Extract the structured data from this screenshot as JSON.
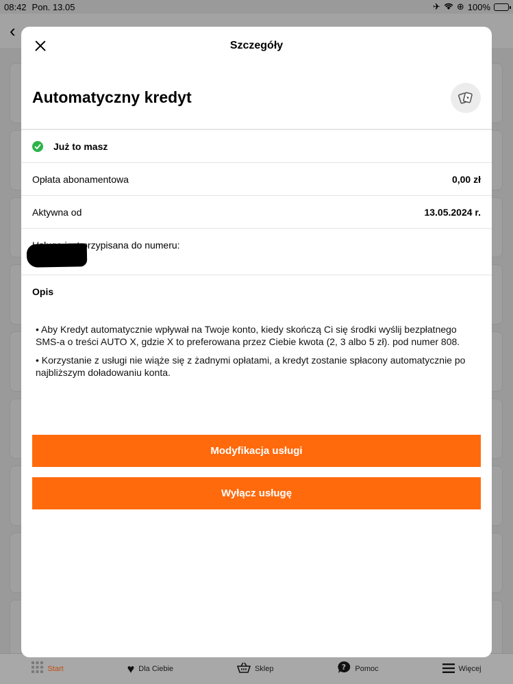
{
  "status_bar": {
    "time": "08:42",
    "date": "Pon. 13.05",
    "battery": "100%"
  },
  "modal": {
    "title": "Szczegóły",
    "service_name": "Automatyczny kredyt",
    "owned_label": "Już to masz",
    "fee_label": "Opłata abonamentowa",
    "fee_value": "0,00 zł",
    "active_label": "Aktywna od",
    "active_value": "13.05.2024 r.",
    "assigned_label": "Usługa jest przypisana do numeru:",
    "description_title": "Opis",
    "description_items": [
      "• Aby Kredyt automatycznie wpływał na Twoje konto, kiedy skończą Ci się środki wyślij bezpłatnego SMS-a o treści AUTO X, gdzie X to preferowana przez Ciebie kwota (2, 3 albo 5 zł). pod numer 808.",
      "• Korzystanie z usługi nie wiąże się z żadnymi opłatami, a kredyt zostanie spłacony automatycznie po najbliższym doładowaniu konta."
    ],
    "modify_button": "Modyfikacja usługi",
    "disable_button": "Wyłącz usługę"
  },
  "tabbar": {
    "items": [
      {
        "label": "Start",
        "icon": "grid-icon",
        "active": true
      },
      {
        "label": "Dla Ciebie",
        "icon": "heart-icon"
      },
      {
        "label": "Sklep",
        "icon": "basket-icon"
      },
      {
        "label": "Pomoc",
        "icon": "help-bubble-icon"
      },
      {
        "label": "Więcej",
        "icon": "menu-icon"
      }
    ]
  },
  "colors": {
    "accent": "#ff6a0d",
    "success": "#2cb34a"
  }
}
